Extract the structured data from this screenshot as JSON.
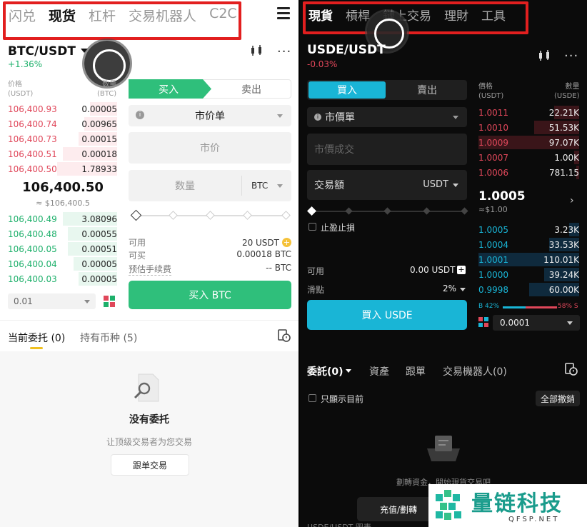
{
  "left": {
    "nav": [
      "闪兑",
      "现货",
      "杠杆",
      "交易机器人",
      "C2C"
    ],
    "nav_active": 1,
    "pair": "BTC/USDT",
    "change": "+1.36%",
    "ob_header": {
      "price": "价格",
      "price_unit": "(USDT)",
      "qty": "数量",
      "qty_unit": "(BTC)"
    },
    "asks": [
      {
        "price": "106,400.93",
        "qty": "0.00005",
        "depth": 0.25
      },
      {
        "price": "106,400.74",
        "qty": "0.00965",
        "depth": 0.3
      },
      {
        "price": "106,400.73",
        "qty": "0.00015",
        "depth": 0.35
      },
      {
        "price": "106,400.51",
        "qty": "0.00018",
        "depth": 0.5
      },
      {
        "price": "106,400.50",
        "qty": "1.78933",
        "depth": 0.55
      }
    ],
    "last_price": "106,400.50",
    "last_price_fiat": "≈ $106,400.5",
    "bids": [
      {
        "price": "106,400.49",
        "qty": "3.08096",
        "depth": 0.5
      },
      {
        "price": "106,400.48",
        "qty": "0.00055",
        "depth": 0.45
      },
      {
        "price": "106,400.05",
        "qty": "0.00051",
        "depth": 0.45
      },
      {
        "price": "106,400.04",
        "qty": "0.00005",
        "depth": 0.4
      },
      {
        "price": "106,400.03",
        "qty": "0.00005",
        "depth": 0.35
      }
    ],
    "depth_select": "0.01",
    "buy_tab": "买入",
    "sell_tab": "卖出",
    "order_type": "市价单",
    "market_price": "市价",
    "qty_placeholder": "数量",
    "qty_unit": "BTC",
    "available_label": "可用",
    "available_value": "20 USDT",
    "can_buy_label": "可买",
    "can_buy_value": "0.00018 BTC",
    "fee_label": "预估手续费",
    "fee_value": "-- BTC",
    "buy_button": "买入 BTC",
    "bottom_tabs": [
      "当前委托 (0)",
      "持有币种 (5)"
    ],
    "empty_title": "没有委托",
    "empty_sub": "让顶级交易者为您交易",
    "copy_trade_button": "跟单交易"
  },
  "right": {
    "nav": [
      "現貨",
      "槓桿",
      "鏈上交易",
      "理財",
      "工具"
    ],
    "nav_active": 0,
    "pair": "USDE/USDT",
    "change": "-0.03%",
    "buy_tab": "買入",
    "sell_tab": "賣出",
    "order_type": "市價單",
    "market_fill": "市價成交",
    "amount_label": "交易額",
    "amount_unit": "USDT",
    "tpsl": "止盈止損",
    "available_label": "可用",
    "available_value": "0.00 USDT",
    "slippage_label": "滑點",
    "slippage_value": "2%",
    "buy_button": "買入 USDE",
    "ob_header": {
      "price": "價格",
      "price_unit": "(USDT)",
      "qty": "數量",
      "qty_unit": "(USDE)"
    },
    "asks": [
      {
        "price": "1.0011",
        "qty": "22.21K",
        "depth": 0.25
      },
      {
        "price": "1.0010",
        "qty": "51.53K",
        "depth": 0.45
      },
      {
        "price": "1.0009",
        "qty": "97.07K",
        "depth": 1.0
      },
      {
        "price": "1.0007",
        "qty": "1.00K",
        "depth": 0.05
      },
      {
        "price": "1.0006",
        "qty": "781.15",
        "depth": 0.03
      }
    ],
    "last_price": "1.0005",
    "last_price_fiat": "≈$1.00",
    "bids": [
      {
        "price": "1.0005",
        "qty": "3.23K",
        "depth": 0.1
      },
      {
        "price": "1.0004",
        "qty": "33.53K",
        "depth": 0.3
      },
      {
        "price": "1.0001",
        "qty": "110.01K",
        "depth": 1.0
      },
      {
        "price": "1.0000",
        "qty": "39.24K",
        "depth": 0.35
      },
      {
        "price": "0.9998",
        "qty": "60.00K",
        "depth": 0.5
      }
    ],
    "ratio_buy": "B 42%",
    "ratio_sell": "58% S",
    "ratio_buy_fraction": 0.42,
    "depth_select": "0.0001",
    "bottom_tabs": [
      "委託(0)",
      "資產",
      "跟單",
      "交易機器人(0)"
    ],
    "only_current": "只顯示目前",
    "cancel_all": "全部撤銷",
    "empty_sub": "劃轉資金，開始現貨交易吧",
    "deposit_button": "充值/劃轉",
    "footer_pair": "USDE/USDT 圖表"
  },
  "watermark": {
    "brand": "量链科技",
    "url": "QFSP.NET"
  },
  "colors": {
    "buy_green": "#2fbf7b",
    "ask_red": "#e0475a",
    "cyan": "#19b5d6",
    "highlight": "#e21f1f"
  }
}
